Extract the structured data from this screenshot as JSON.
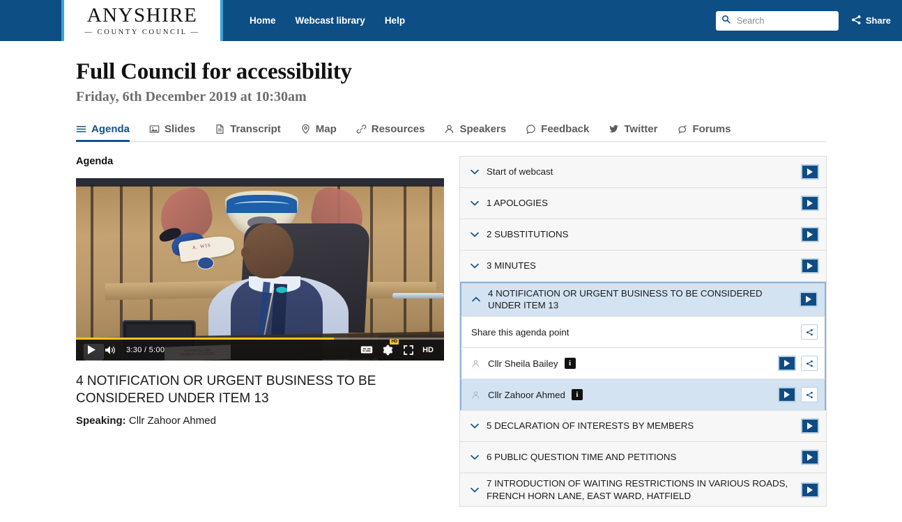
{
  "header": {
    "logo_main": "ANYSHIRE",
    "logo_sub": "— COUNTY COUNCIL —",
    "nav": [
      {
        "label": "Home"
      },
      {
        "label": "Webcast library"
      },
      {
        "label": "Help"
      }
    ],
    "search": {
      "placeholder": "Search",
      "value": ""
    },
    "share_label": "Share",
    "accent_color": "#0d4e84",
    "stripe_color": "#3aa3d6"
  },
  "page": {
    "title": "Full Council for accessibility",
    "subtitle": "Friday, 6th December 2019 at 10:30am"
  },
  "tabs": [
    {
      "label": "Agenda",
      "icon": "list-icon",
      "active": true
    },
    {
      "label": "Slides",
      "icon": "image-icon",
      "active": false
    },
    {
      "label": "Transcript",
      "icon": "document-icon",
      "active": false
    },
    {
      "label": "Map",
      "icon": "map-pin-icon",
      "active": false
    },
    {
      "label": "Resources",
      "icon": "link-icon",
      "active": false
    },
    {
      "label": "Speakers",
      "icon": "person-icon",
      "active": false
    },
    {
      "label": "Feedback",
      "icon": "comment-icon",
      "active": false
    },
    {
      "label": "Twitter",
      "icon": "twitter-icon",
      "active": false
    },
    {
      "label": "Forums",
      "icon": "forums-icon",
      "active": false
    }
  ],
  "main": {
    "section_heading": "Agenda",
    "player": {
      "current_time": "3:30",
      "duration": "5:00",
      "time_display": "3:30 / 5:00",
      "progress_percent": 70,
      "progress_color": "#f5c518",
      "quality_label": "HD",
      "quality_badge": "HD",
      "nameplate_line1": "COUNCILLOR",
      "nameplate_line2": "SAMUEL KASUMU",
      "crest_motto": "A. WIS"
    },
    "caption": {
      "title": "4 NOTIFICATION OR URGENT BUSINESS TO BE CONSIDERED UNDER ITEM 13",
      "speaking_label": "Speaking:",
      "speaking_name": "Cllr Zahoor Ahmed"
    }
  },
  "agenda": {
    "share_point_label": "Share this agenda point",
    "items": [
      {
        "label": "Start of webcast",
        "expanded": false
      },
      {
        "label": "1 APOLOGIES",
        "expanded": false
      },
      {
        "label": "2 SUBSTITUTIONS",
        "expanded": false
      },
      {
        "label": "3 MINUTES",
        "expanded": false
      },
      {
        "label": "4 NOTIFICATION OR URGENT BUSINESS TO BE CONSIDERED UNDER ITEM 13",
        "expanded": true
      },
      {
        "label": "5 DECLARATION OF INTERESTS BY MEMBERS",
        "expanded": false
      },
      {
        "label": "6 PUBLIC QUESTION TIME AND PETITIONS",
        "expanded": false
      },
      {
        "label": "7 INTRODUCTION OF WAITING RESTRICTIONS IN VARIOUS ROADS, FRENCH HORN LANE, EAST WARD, HATFIELD",
        "expanded": false
      }
    ],
    "speakers": [
      {
        "name": "Cllr Sheila Bailey",
        "info": "i",
        "active": false
      },
      {
        "name": "Cllr Zahoor Ahmed",
        "info": "i",
        "active": true
      }
    ]
  }
}
